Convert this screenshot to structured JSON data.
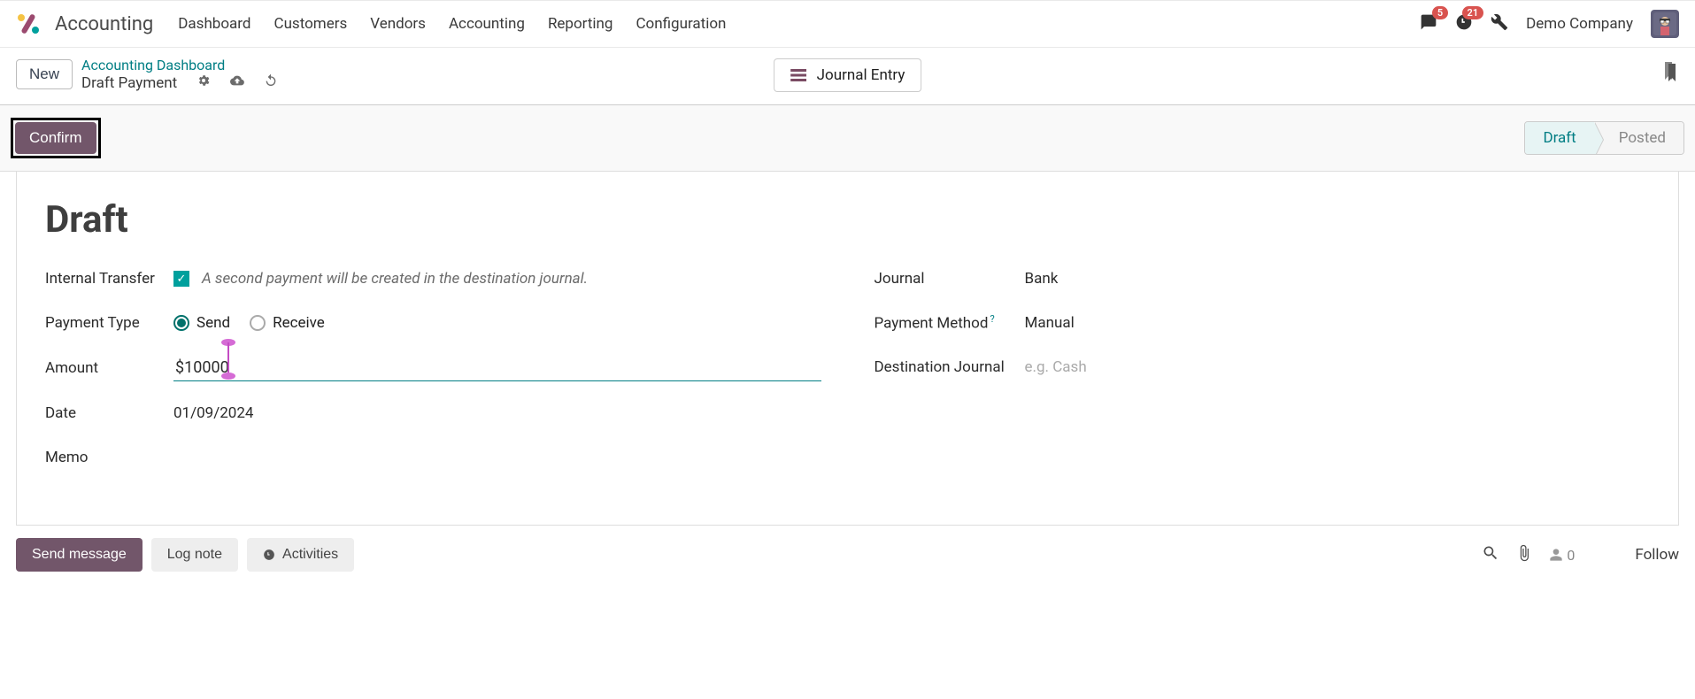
{
  "header": {
    "app_name": "Accounting",
    "nav": [
      "Dashboard",
      "Customers",
      "Vendors",
      "Accounting",
      "Reporting",
      "Configuration"
    ],
    "messages_badge": "5",
    "activities_badge": "21",
    "company_name": "Demo Company"
  },
  "breadcrumb": {
    "new_label": "New",
    "parent_link": "Accounting Dashboard",
    "current": "Draft Payment",
    "journal_entry_label": "Journal Entry"
  },
  "actions": {
    "confirm_label": "Confirm",
    "status_active": "Draft",
    "status_inactive": "Posted"
  },
  "form": {
    "title": "Draft",
    "left": {
      "internal_transfer_label": "Internal Transfer",
      "internal_transfer_checked": true,
      "internal_transfer_note": "A second payment will be created in the destination journal.",
      "payment_type_label": "Payment Type",
      "payment_type_send": "Send",
      "payment_type_receive": "Receive",
      "payment_type_selected": "Send",
      "amount_label": "Amount",
      "amount_value": "$10000",
      "date_label": "Date",
      "date_value": "01/09/2024",
      "memo_label": "Memo"
    },
    "right": {
      "journal_label": "Journal",
      "journal_value": "Bank",
      "payment_method_label": "Payment Method",
      "payment_method_value": "Manual",
      "destination_journal_label": "Destination Journal",
      "destination_journal_placeholder": "e.g. Cash"
    }
  },
  "chat": {
    "send_message_label": "Send message",
    "log_note_label": "Log note",
    "activities_label": "Activities",
    "followers_count": "0",
    "follow_label": "Follow"
  }
}
